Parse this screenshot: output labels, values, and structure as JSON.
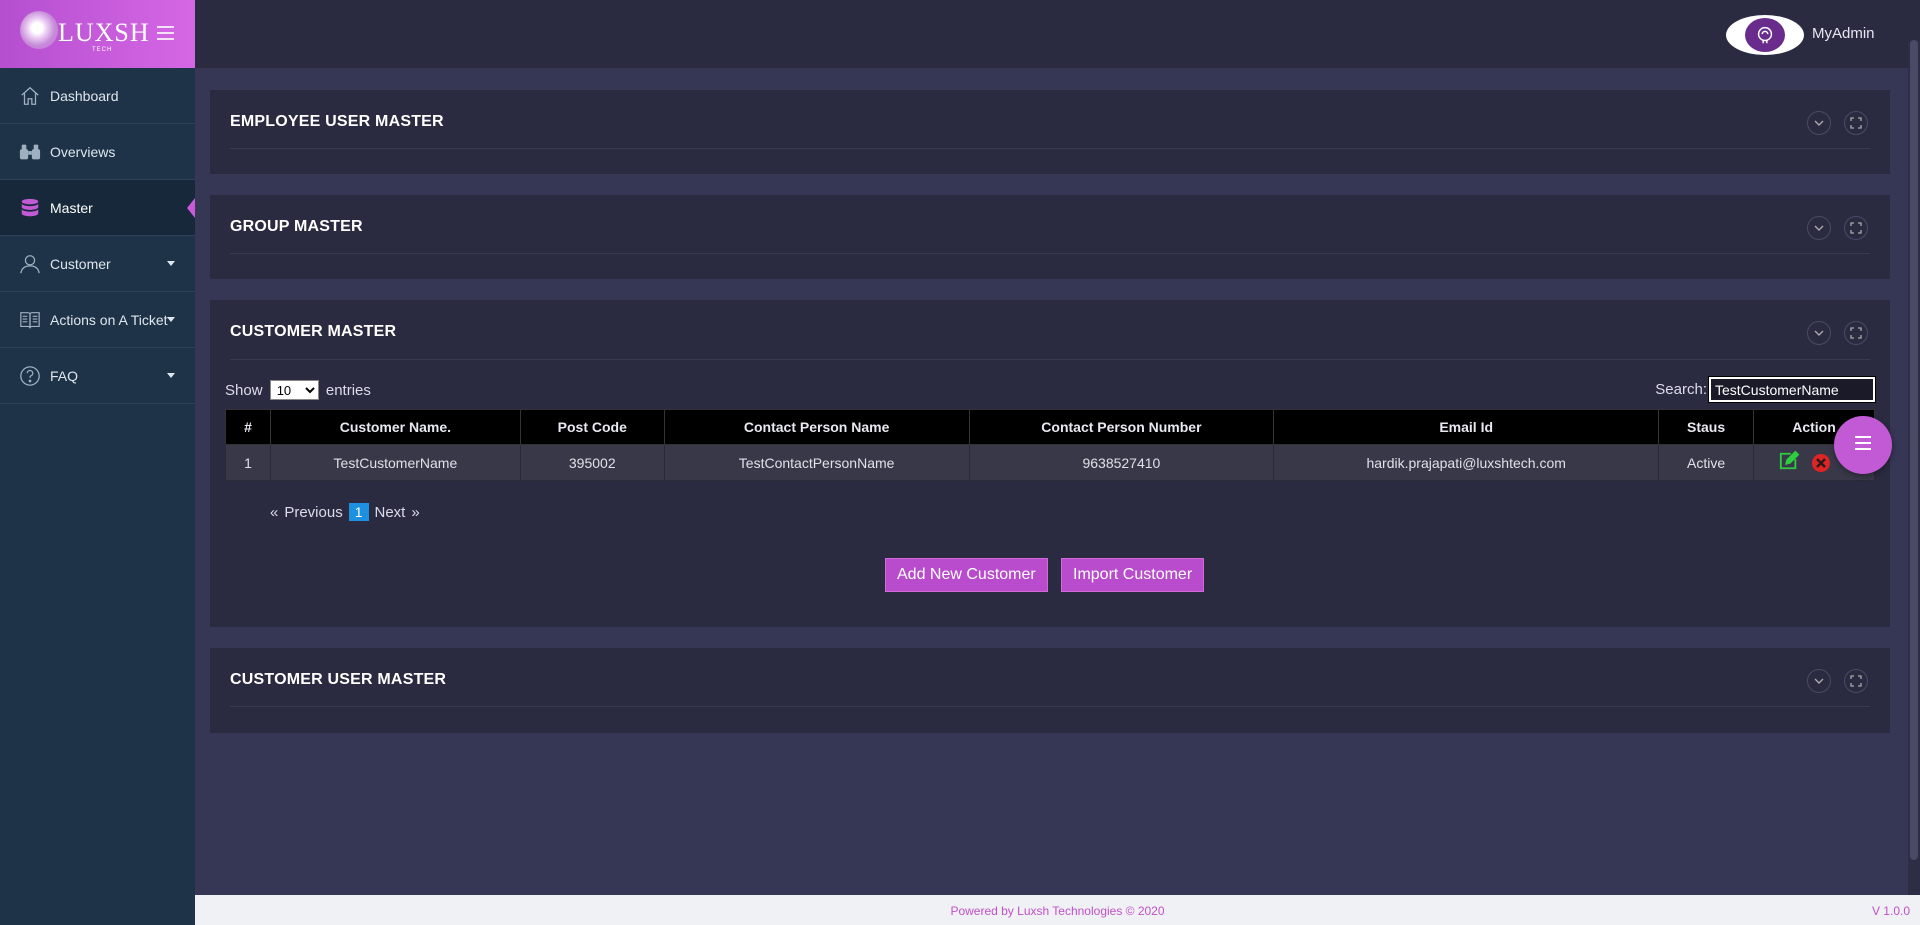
{
  "brand": {
    "logo_text": "LUXSH",
    "logo_sub": "TECH"
  },
  "sidebar": {
    "items": [
      {
        "label": "Dashboard",
        "icon": "home-icon"
      },
      {
        "label": "Overviews",
        "icon": "binoculars-icon"
      },
      {
        "label": "Master",
        "icon": "database-icon",
        "active": true
      },
      {
        "label": "Customer",
        "icon": "user-icon",
        "dropdown": true
      },
      {
        "label": "Actions on A Ticket",
        "icon": "book-icon",
        "dropdown": true
      },
      {
        "label": "FAQ",
        "icon": "question-icon",
        "dropdown": true
      }
    ]
  },
  "header": {
    "username": "MyAdmin"
  },
  "panels": {
    "employee": {
      "title": "EMPLOYEE USER MASTER"
    },
    "group": {
      "title": "GROUP MASTER"
    },
    "customer": {
      "title": "CUSTOMER MASTER"
    },
    "customer_user": {
      "title": "CUSTOMER USER MASTER"
    }
  },
  "table": {
    "show_label": "Show",
    "entries_label": "entries",
    "page_size": "10",
    "search_label": "Search:",
    "search_value": "TestCustomerName",
    "columns": [
      "#",
      "Customer Name.",
      "Post Code",
      "Contact Person Name",
      "Contact Person Number",
      "Email Id",
      "Staus",
      "Action"
    ],
    "rows": [
      {
        "num": "1",
        "name": "TestCustomerName",
        "post_code": "395002",
        "contact_name": "TestContactPersonName",
        "contact_number": "9638527410",
        "email": "hardik.prajapati@luxshtech.com",
        "status": "Active"
      }
    ]
  },
  "pagination": {
    "first": "«",
    "previous": "Previous",
    "current": "1",
    "next": "Next",
    "last": "»"
  },
  "buttons": {
    "add": "Add New Customer",
    "import": "Import Customer"
  },
  "footer": {
    "powered": "Powered by Luxsh Technologies © 2020",
    "version": "V 1.0.0"
  },
  "colors": {
    "accent": "#c25ad6",
    "sidebar": "#1e3347",
    "panel": "#2a2a40",
    "background": "#363655",
    "edit": "#2ecc40",
    "delete": "#e02424"
  }
}
